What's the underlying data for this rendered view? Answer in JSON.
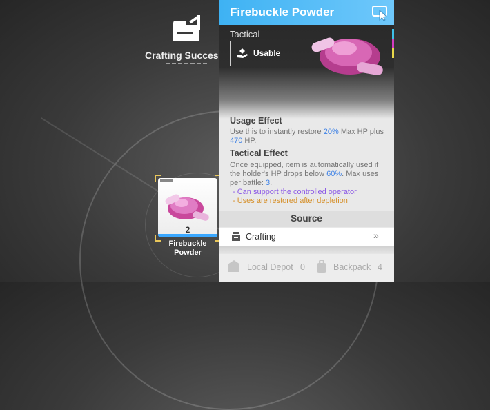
{
  "crafting": {
    "label": "Crafting Success"
  },
  "item_card": {
    "count": "2",
    "name": "Firebuckle Powder"
  },
  "panel": {
    "title": "Firebuckle Powder",
    "category": "Tactical",
    "status": "Usable",
    "usage_heading": "Usage Effect",
    "usage": {
      "pre": "Use this to instantly restore ",
      "pct": "20%",
      "mid": " Max HP plus ",
      "hp": "470",
      "post": " HP."
    },
    "tactical_heading": "Tactical Effect",
    "tactical": {
      "pre": "Once equipped, item is automatically used if the holder's HP drops below ",
      "pct": "60%",
      "mid": ". Max uses per battle: ",
      "uses": "3",
      "post": "."
    },
    "note1": "- Can support the controlled operator",
    "note2": "- Uses are restored after depletion",
    "source_heading": "Source",
    "source_item": "Crafting",
    "chevron": "»",
    "local_depot": {
      "label": "Local Depot",
      "count": "0"
    },
    "backpack": {
      "label": "Backpack",
      "count": "4"
    }
  },
  "colors": {
    "header": "#3eb2f3",
    "highlight": "#3f82e6",
    "note_purple": "#8c5ae6",
    "note_orange": "#d6902a",
    "frame_gold": "#e8c65a"
  },
  "icons": [
    "crafting-box-icon",
    "pointer-cursor-icon",
    "use-hand-icon",
    "crafting-station-icon",
    "depot-icon",
    "backpack-icon"
  ]
}
